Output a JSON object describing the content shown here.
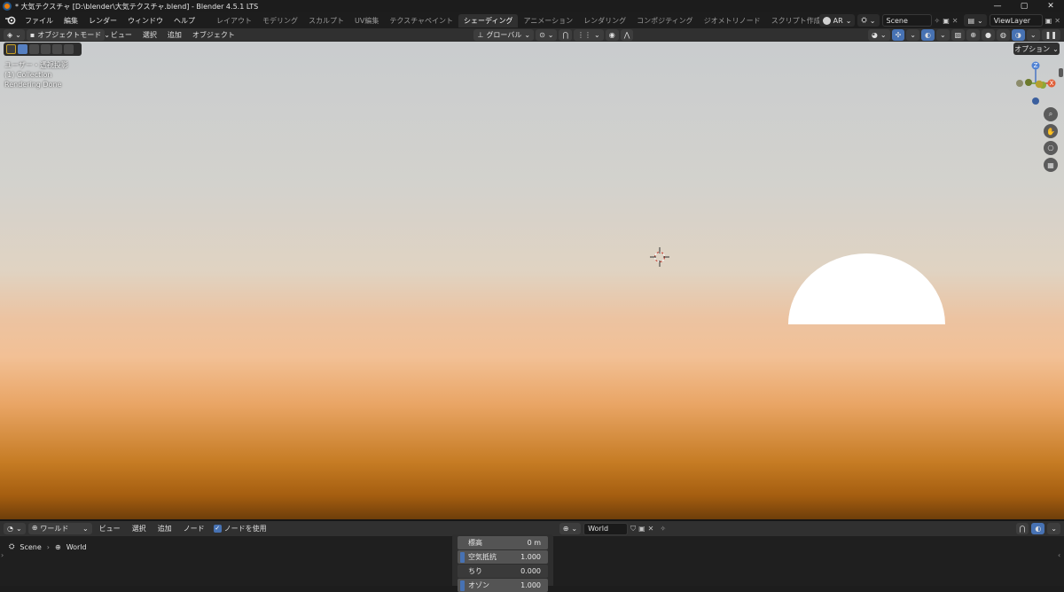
{
  "window": {
    "title": "* 大気テクスチャ [D:\\blender\\大気テクスチャ.blend] - Blender 4.5.1 LTS",
    "minimize": "—",
    "maximize": "▢",
    "close": "✕"
  },
  "menubar": {
    "items": [
      "ファイル",
      "編集",
      "レンダー",
      "ウィンドウ",
      "ヘルプ"
    ],
    "workspaces": [
      "レイアウト",
      "モデリング",
      "スカルプト",
      "UV編集",
      "テクスチャペイント",
      "シェーディング",
      "アニメーション",
      "レンダリング",
      "コンポジティング",
      "ジオメトリノード",
      "スクリプト作成"
    ],
    "active_workspace": "シェーディング",
    "add_tab": "+",
    "engine_label": "AR",
    "scene": "Scene",
    "view_layer": "ViewLayer"
  },
  "viewport_header": {
    "mode": "オブジェクトモード",
    "menus": [
      "ビュー",
      "選択",
      "追加",
      "オブジェクト"
    ],
    "transform_orientation": "グローバル"
  },
  "viewport": {
    "view_name": "ユーザー・透視投影",
    "collection": "(1) Collection",
    "status": "Rendering Done",
    "options_label": "オプション",
    "gizmo": {
      "z": "Z",
      "x": "X"
    },
    "colors": {
      "sun": "#ffffff",
      "sky_top": "#c9ccce",
      "horizon": "#f2c095",
      "ground": "#a55e10"
    }
  },
  "node_header": {
    "world_label": "ワールド",
    "menus": [
      "ビュー",
      "選択",
      "追加",
      "ノード"
    ],
    "use_nodes_label": "ノードを使用",
    "use_nodes_checked": true,
    "datablock": "World"
  },
  "breadcrumb": {
    "scene": "Scene",
    "world": "World",
    "separator": "›"
  },
  "sky_panel": {
    "rows": [
      {
        "label": "標高",
        "value": "0 m",
        "marked": false
      },
      {
        "label": "空気抵抗",
        "value": "1.000",
        "marked": true
      },
      {
        "label": "ちり",
        "value": "0.000",
        "marked": false
      },
      {
        "label": "オゾン",
        "value": "1.000",
        "marked": true
      }
    ]
  }
}
